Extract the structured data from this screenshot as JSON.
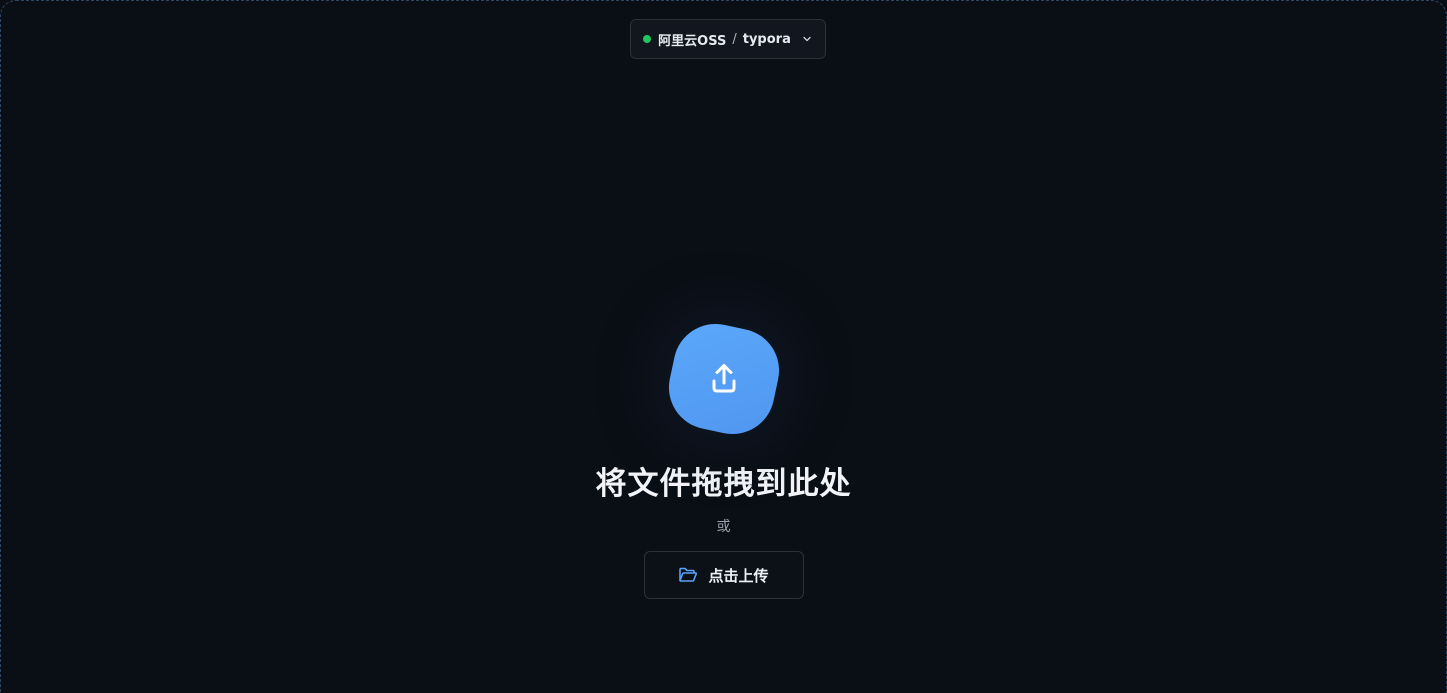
{
  "source": {
    "provider": "阿里云OSS",
    "separator": "/",
    "bucket": "typora",
    "status_color": "#22c55e",
    "chevron_icon": "chevron-down-icon"
  },
  "dropzone": {
    "icon": "upload-icon",
    "title": "将文件拖拽到此处",
    "or_text": "或",
    "button_label": "点击上传",
    "button_icon": "folder-open-icon",
    "accent_color": "#5aa2f8"
  }
}
